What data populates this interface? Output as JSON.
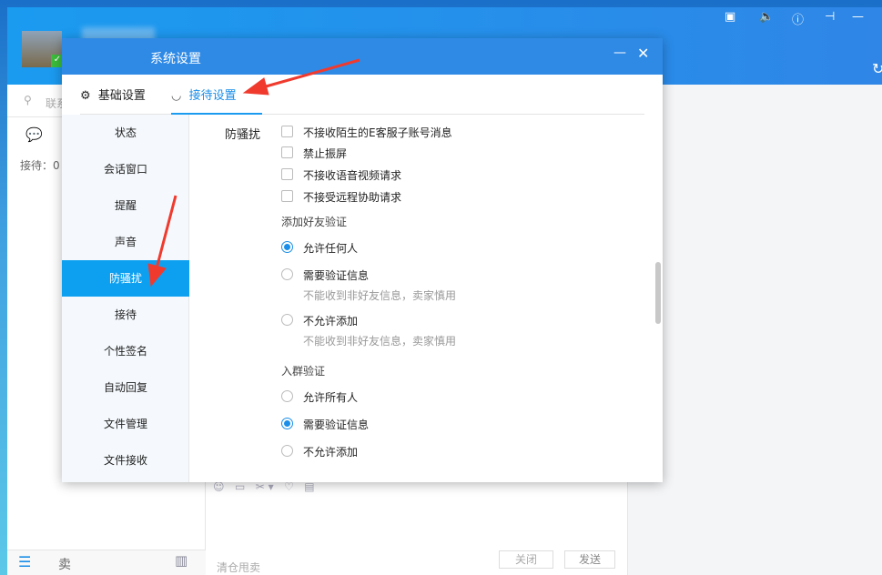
{
  "app": {
    "receive_count": "接待：0",
    "search_placeholder": "联系",
    "bottom_tab": "卖",
    "input_placeholder": "清仓甩卖",
    "close_btn": "关闭",
    "send_btn": "发送"
  },
  "dialog": {
    "title": "系统设置",
    "tabs": [
      {
        "label": "基础设置"
      },
      {
        "label": "接待设置"
      }
    ],
    "sidebar": [
      "状态",
      "会话窗口",
      "提醒",
      "声音",
      "防骚扰",
      "接待",
      "个性签名",
      "自动回复",
      "文件管理",
      "文件接收"
    ],
    "section_label": "防骚扰",
    "checkboxes": [
      "不接收陌生的E客服子账号消息",
      "禁止振屏",
      "不接收语音视频请求",
      "不接受远程协助请求"
    ],
    "friend_title": "添加好友验证",
    "friend_opts": [
      {
        "label": "允许任何人",
        "checked": true
      },
      {
        "label": "需要验证信息",
        "hint": "不能收到非好友信息，卖家慎用"
      },
      {
        "label": "不允许添加",
        "hint": "不能收到非好友信息，卖家慎用"
      }
    ],
    "group_title": "入群验证",
    "group_opts": [
      {
        "label": "允许所有人"
      },
      {
        "label": "需要验证信息",
        "checked": true
      },
      {
        "label": "不允许添加"
      }
    ]
  },
  "colors": {
    "accent": "#0ea0f0",
    "title": "#2f8ae6",
    "arrow": "#f03a2e"
  }
}
